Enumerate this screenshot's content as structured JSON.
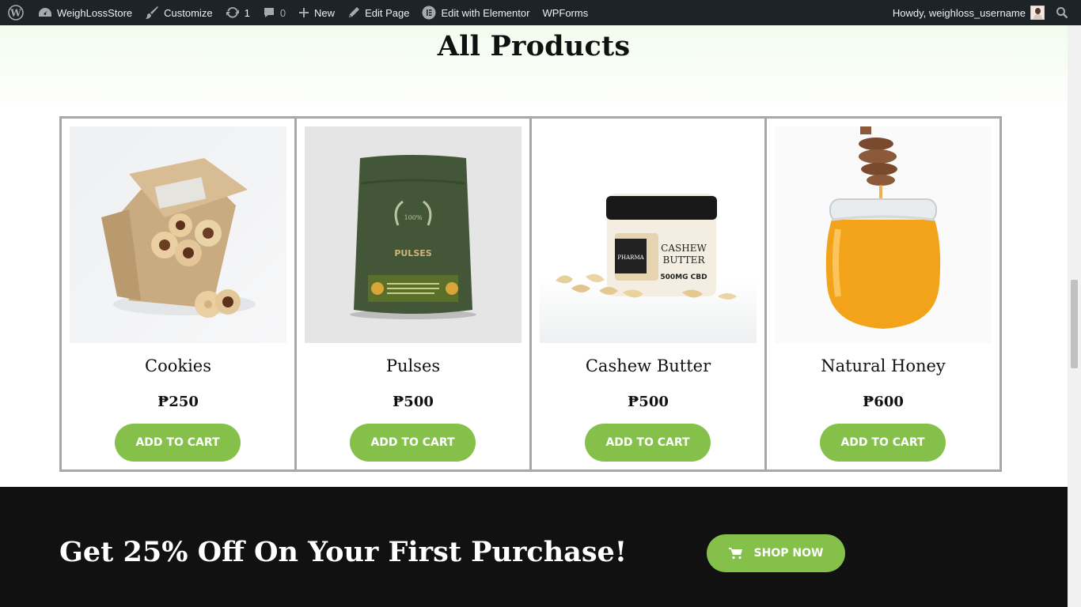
{
  "adminbar": {
    "site_name": "WeighLossStore",
    "customize": "Customize",
    "updates_count": "1",
    "comments_count": "0",
    "new": "New",
    "edit_page": "Edit Page",
    "elementor": "Edit with Elementor",
    "wpforms": "WPForms",
    "howdy": "Howdy, weighloss_username"
  },
  "page": {
    "title": "All Products"
  },
  "products": [
    {
      "name": "Cookies",
      "price": "₱250",
      "button": "ADD TO CART"
    },
    {
      "name": "Pulses",
      "price": "₱500",
      "button": "ADD TO CART"
    },
    {
      "name": "Cashew Butter",
      "price": "₱500",
      "button": "ADD TO CART"
    },
    {
      "name": "Natural Honey",
      "price": "₱600",
      "button": "ADD TO CART"
    }
  ],
  "pouch_text": "PULSES",
  "jar_label": {
    "line1": "CASHEW",
    "line2": "BUTTER",
    "line3": "500MG CBD"
  },
  "promo": {
    "heading": "Get 25% Off On Your First Purchase!",
    "button": "SHOP NOW"
  },
  "colors": {
    "accent": "#85c14a",
    "adminbar": "#1d2327",
    "promo_bg": "#111111"
  }
}
